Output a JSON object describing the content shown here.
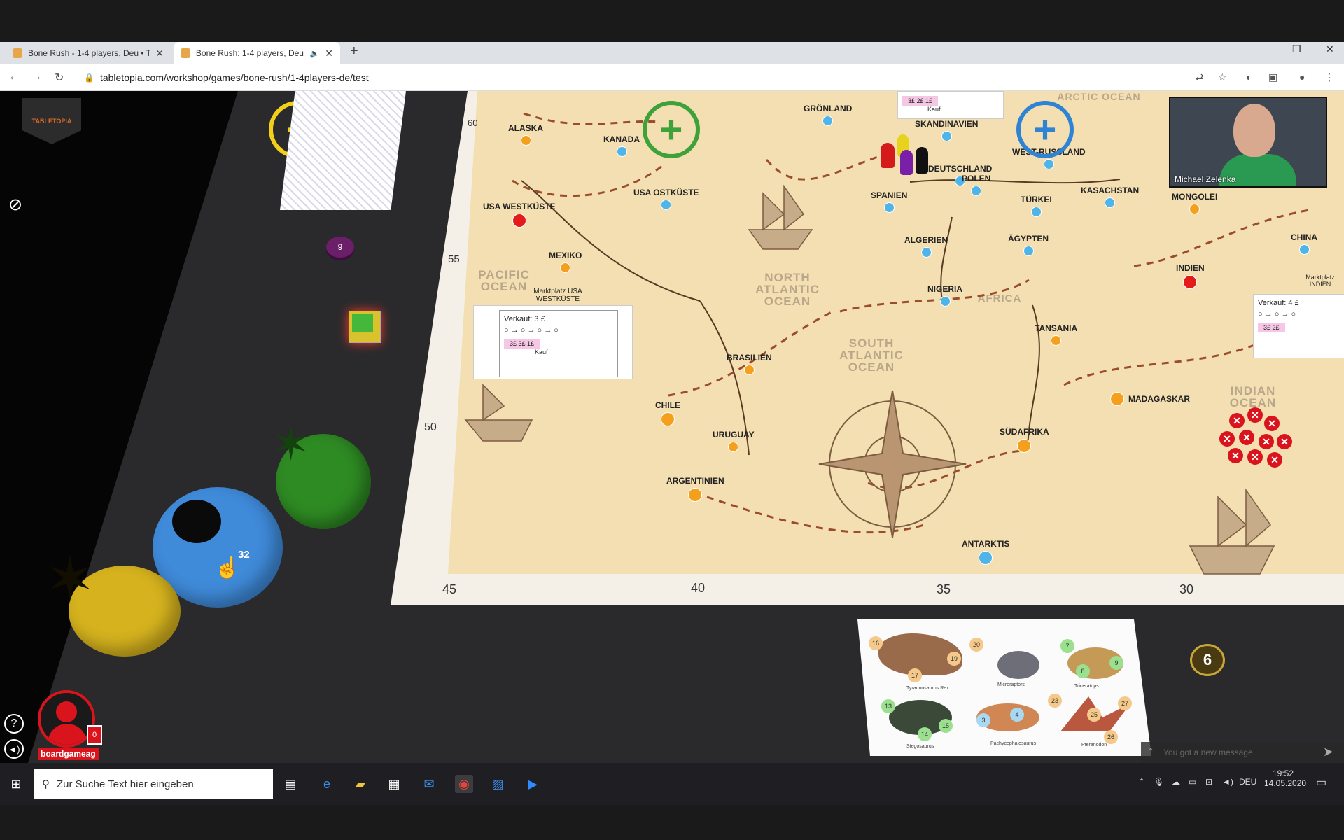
{
  "browser": {
    "tabs": [
      {
        "title": "Bone Rush - 1-4 players, Deu • Ta"
      },
      {
        "title": "Bone Rush: 1-4 players, Deu"
      }
    ],
    "url": "tabletopia.com/workshop/games/bone-rush/1-4players-de/test"
  },
  "game": {
    "logo_text": "TABLETOPIA",
    "bag_count": "32",
    "pawn_token": "9",
    "dice_value": "6",
    "player": {
      "name": "boardgameag",
      "card_count": "0"
    },
    "webcam_name": "Michael Zelenka",
    "chat_placeholder": "You got a new message",
    "board_scale": {
      "y_left": [
        "60",
        "55",
        "50"
      ],
      "x_bottom": [
        "45",
        "40",
        "35",
        "30"
      ]
    },
    "oceans": [
      "PACIFIC OCEAN",
      "NORTH ATLANTIC OCEAN",
      "SOUTH ATLANTIC OCEAN",
      "INDIAN OCEAN",
      "ARCTIC OCEAN",
      "AFRICA"
    ],
    "cities": [
      "ALASKA",
      "KANADA",
      "GRÖNLAND",
      "SKANDINAVIEN",
      "WEST-RUSSLAND",
      "DEUTSCHLAND",
      "POLEN",
      "USA WESTKÜSTE",
      "USA OSTKÜSTE",
      "SPANIEN",
      "TÜRKEI",
      "KASACHSTAN",
      "MONGOLEI",
      "CHINA",
      "ALGERIEN",
      "ÄGYPTEN",
      "MEXIKO",
      "NIGERIA",
      "INDIEN",
      "TANSANIA",
      "BRASILIEN",
      "MADAGASKAR",
      "CHILE",
      "URUGUAY",
      "SÜDAFRIKA",
      "ARGENTINIEN",
      "ANTARKTIS"
    ],
    "market_cards": [
      {
        "title": "Marktplatz USA WESTKÜSTE",
        "sale": "Verkauf: 3 £",
        "prices": "3£   3£   1£",
        "buy": "Kauf"
      },
      {
        "title": "Marktplatz INDIEN",
        "sale": "Verkauf: 4 £",
        "prices": "3£   2£",
        "buy": "Kauf"
      }
    ],
    "top_card": {
      "prices": "3£   2£   1£",
      "buy": "Kauf"
    },
    "dino_card": {
      "dinos": [
        "Tyrannosaurus Rex",
        "Microraptors",
        "Triceratops",
        "Stegosaurus",
        "Pachycephalosaurus",
        "Pteranodon"
      ],
      "numbers": [
        "16",
        "20",
        "17",
        "19",
        "7",
        "9",
        "8",
        "23",
        "27",
        "25",
        "26",
        "13",
        "14",
        "3",
        "15",
        "4"
      ]
    }
  },
  "taskbar": {
    "search_placeholder": "Zur Suche Text hier eingeben",
    "lang": "DEU",
    "time": "19:52",
    "date": "14.05.2020"
  }
}
